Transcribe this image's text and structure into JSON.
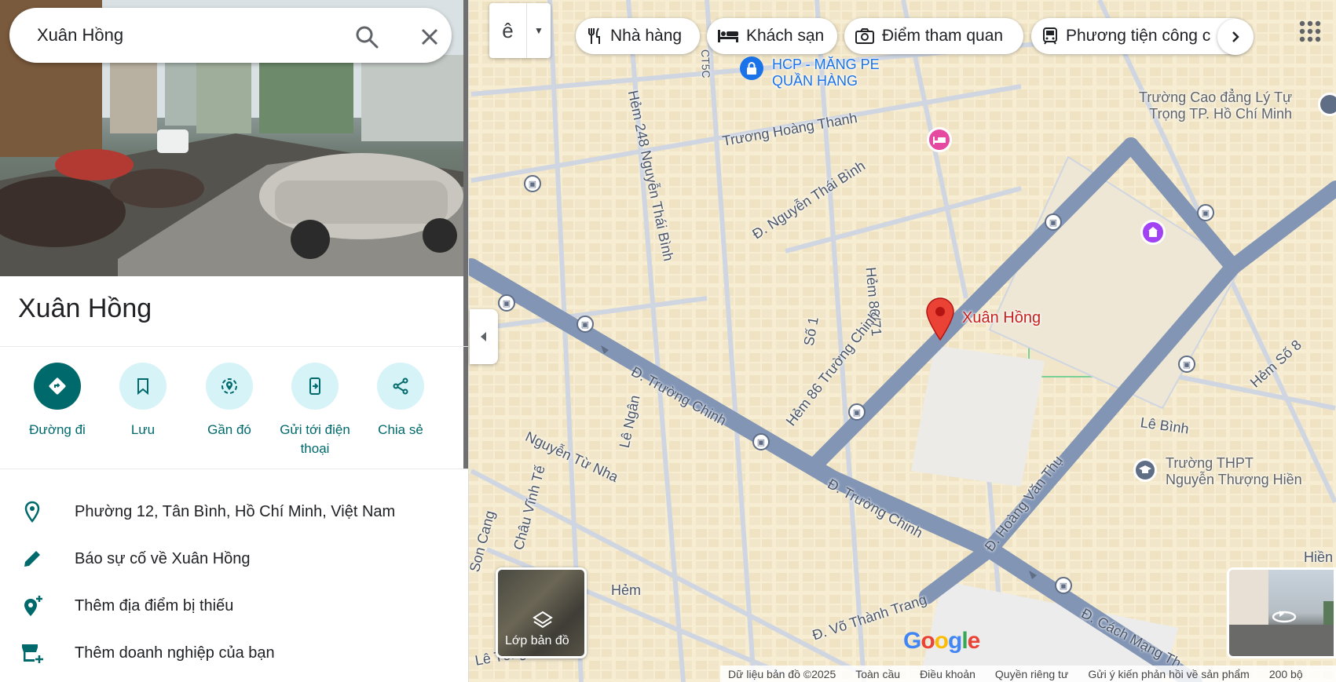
{
  "search": {
    "value": "Xuân Hồng"
  },
  "place": {
    "title": "Xuân Hồng"
  },
  "actions": [
    {
      "label": "Đường đi"
    },
    {
      "label": "Lưu"
    },
    {
      "label": "Gần đó"
    },
    {
      "label": "Gửi tới điện thoại"
    },
    {
      "label": "Chia sẻ"
    }
  ],
  "info": {
    "address": "Phường 12, Tân Bình, Hồ Chí Minh, Việt Nam",
    "report": "Báo sự cố về Xuân Hồng",
    "add_place": "Thêm địa điểm bị thiếu",
    "add_business": "Thêm doanh nghiệp của bạn"
  },
  "map": {
    "language_button": "ê",
    "chips": [
      {
        "label": "Nhà hàng",
        "icon": "restaurant-icon"
      },
      {
        "label": "Khách sạn",
        "icon": "hotel-icon"
      },
      {
        "label": "Điểm tham quan",
        "icon": "camera-icon"
      },
      {
        "label": "Phương tiện công c",
        "icon": "transit-icon"
      }
    ],
    "pin_label": "Xuân Hồng",
    "poi": {
      "hcp": "HCP - MĂNG PE\nQUẦN HÀNG",
      "college": "Trường Cao đẳng Lý Tự\nTrọng TP. Hồ Chí Minh",
      "highschool": "Trường THPT\nNguyễn Thượng Hiền"
    },
    "streets": {
      "s1": "Trương Hoàng Thanh",
      "s2": "Hẻm 248 Nguyễn Thái Bình",
      "s3": "Đ. Nguyễn Thái Bình",
      "s4": "Hẻm 86/71",
      "s5": "Số 1",
      "s6": "Hẻm 86 Trường Chinh",
      "s7": "Đ. Trường Chinh",
      "s8": "Đ. Trường Chinh",
      "s9": "Lê Ngân",
      "s10": "Nguyễn Từ Nha",
      "s11": "Châu Vĩnh Tế",
      "s12": "Son Cang",
      "s13": "Hẻm",
      "s14": "Đ. Võ Thành Trang",
      "s15": "Đ. Hoàng Văn Thụ",
      "s16": "Lê Bình",
      "s17": "Hẻm Số 8",
      "s18": "Đ. Cách Mạng Th",
      "s19": "Lê Tông",
      "s20": "Hiền",
      "s21": "CT5C"
    },
    "layers_label": "Lớp bản đồ",
    "google_logo": "Google",
    "footer": {
      "data": "Dữ liệu bản đồ ©2025",
      "global": "Toàn cầu",
      "terms": "Điều khoản",
      "privacy": "Quyền riêng tư",
      "feedback": "Gửi ý kiến phản hồi về sản phẩm",
      "scale": "200 bộ"
    }
  },
  "colors": {
    "accent": "#00696b",
    "accent_light": "#d6f4f8",
    "pin": "#ea4335",
    "road_major": "#8295b5",
    "map_bg": "#f6edd3"
  }
}
